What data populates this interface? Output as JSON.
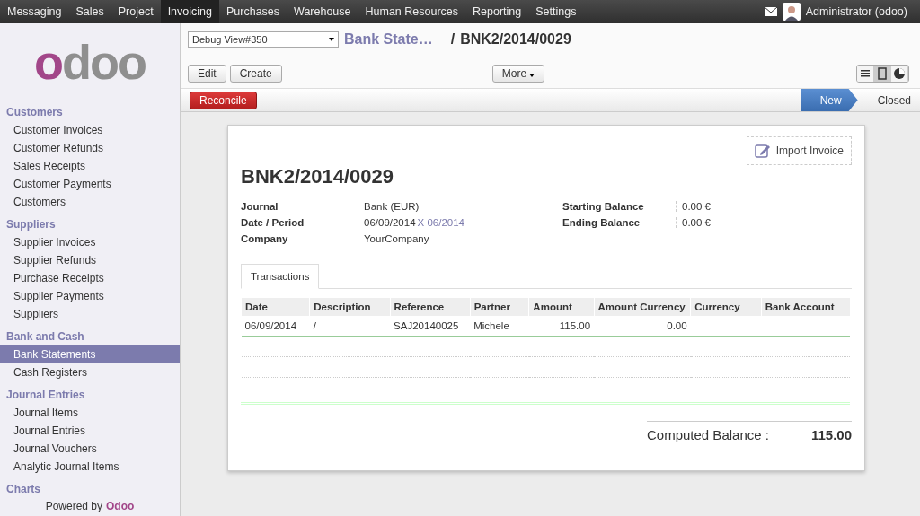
{
  "top_menu": [
    {
      "label": "Messaging",
      "selected": false
    },
    {
      "label": "Sales",
      "selected": false
    },
    {
      "label": "Project",
      "selected": false
    },
    {
      "label": "Invoicing",
      "selected": true
    },
    {
      "label": "Purchases",
      "selected": false
    },
    {
      "label": "Warehouse",
      "selected": false
    },
    {
      "label": "Human Resources",
      "selected": false
    },
    {
      "label": "Reporting",
      "selected": false
    },
    {
      "label": "Settings",
      "selected": false
    }
  ],
  "user": {
    "name": "Administrator (odoo)"
  },
  "sidebar": {
    "logo": "odoo",
    "sections": [
      {
        "title": "Customers",
        "items": [
          {
            "label": "Customer Invoices",
            "selected": false
          },
          {
            "label": "Customer Refunds",
            "selected": false
          },
          {
            "label": "Sales Receipts",
            "selected": false
          },
          {
            "label": "Customer Payments",
            "selected": false
          },
          {
            "label": "Customers",
            "selected": false
          }
        ]
      },
      {
        "title": "Suppliers",
        "items": [
          {
            "label": "Supplier Invoices",
            "selected": false
          },
          {
            "label": "Supplier Refunds",
            "selected": false
          },
          {
            "label": "Purchase Receipts",
            "selected": false
          },
          {
            "label": "Supplier Payments",
            "selected": false
          },
          {
            "label": "Suppliers",
            "selected": false
          }
        ]
      },
      {
        "title": "Bank and Cash",
        "items": [
          {
            "label": "Bank Statements",
            "selected": true
          },
          {
            "label": "Cash Registers",
            "selected": false
          }
        ]
      },
      {
        "title": "Journal Entries",
        "items": [
          {
            "label": "Journal Items",
            "selected": false
          },
          {
            "label": "Journal Entries",
            "selected": false
          },
          {
            "label": "Journal Vouchers",
            "selected": false
          },
          {
            "label": "Analytic Journal Items",
            "selected": false
          }
        ]
      },
      {
        "title": "Charts"
      }
    ],
    "footer": {
      "prefix": "Powered by",
      "brand": "Odoo"
    }
  },
  "debug_select": {
    "value": "Debug View#350"
  },
  "breadcrumb": {
    "parent": "Bank State…",
    "separator": "/",
    "current": "BNK2/2014/0029"
  },
  "buttons": {
    "edit": "Edit",
    "create": "Create",
    "more": "More"
  },
  "view_switcher": [
    {
      "kind": "list",
      "selected": false
    },
    {
      "kind": "form",
      "selected": true
    },
    {
      "kind": "graph",
      "selected": false
    }
  ],
  "reconcile": "Reconcile",
  "statusbar": [
    {
      "label": "New",
      "selected": true
    },
    {
      "label": "Closed",
      "selected": false
    }
  ],
  "form": {
    "import_button": "Import Invoice",
    "title": "BNK2/2014/0029",
    "left_fields": [
      {
        "label": "Journal",
        "value": "Bank (EUR)"
      },
      {
        "label": "Date / Period",
        "value": "06/09/2014",
        "link": "X 06/2014"
      },
      {
        "label": "Company",
        "value": "YourCompany"
      }
    ],
    "right_fields": [
      {
        "label": "Starting Balance",
        "value": "0.00 €"
      },
      {
        "label": "Ending Balance",
        "value": "0.00 €"
      }
    ],
    "tabs": [
      {
        "label": "Transactions",
        "selected": true
      }
    ],
    "table": {
      "columns": [
        "Date",
        "Description",
        "Reference",
        "Partner",
        "Amount",
        "Amount Currency",
        "Currency",
        "Bank Account"
      ],
      "rows": [
        [
          "06/09/2014",
          "/",
          "SAJ20140025",
          "Michele",
          "115.00",
          "0.00",
          "",
          ""
        ]
      ]
    },
    "balance": {
      "label": "Computed Balance :",
      "value": "115.00"
    }
  }
}
